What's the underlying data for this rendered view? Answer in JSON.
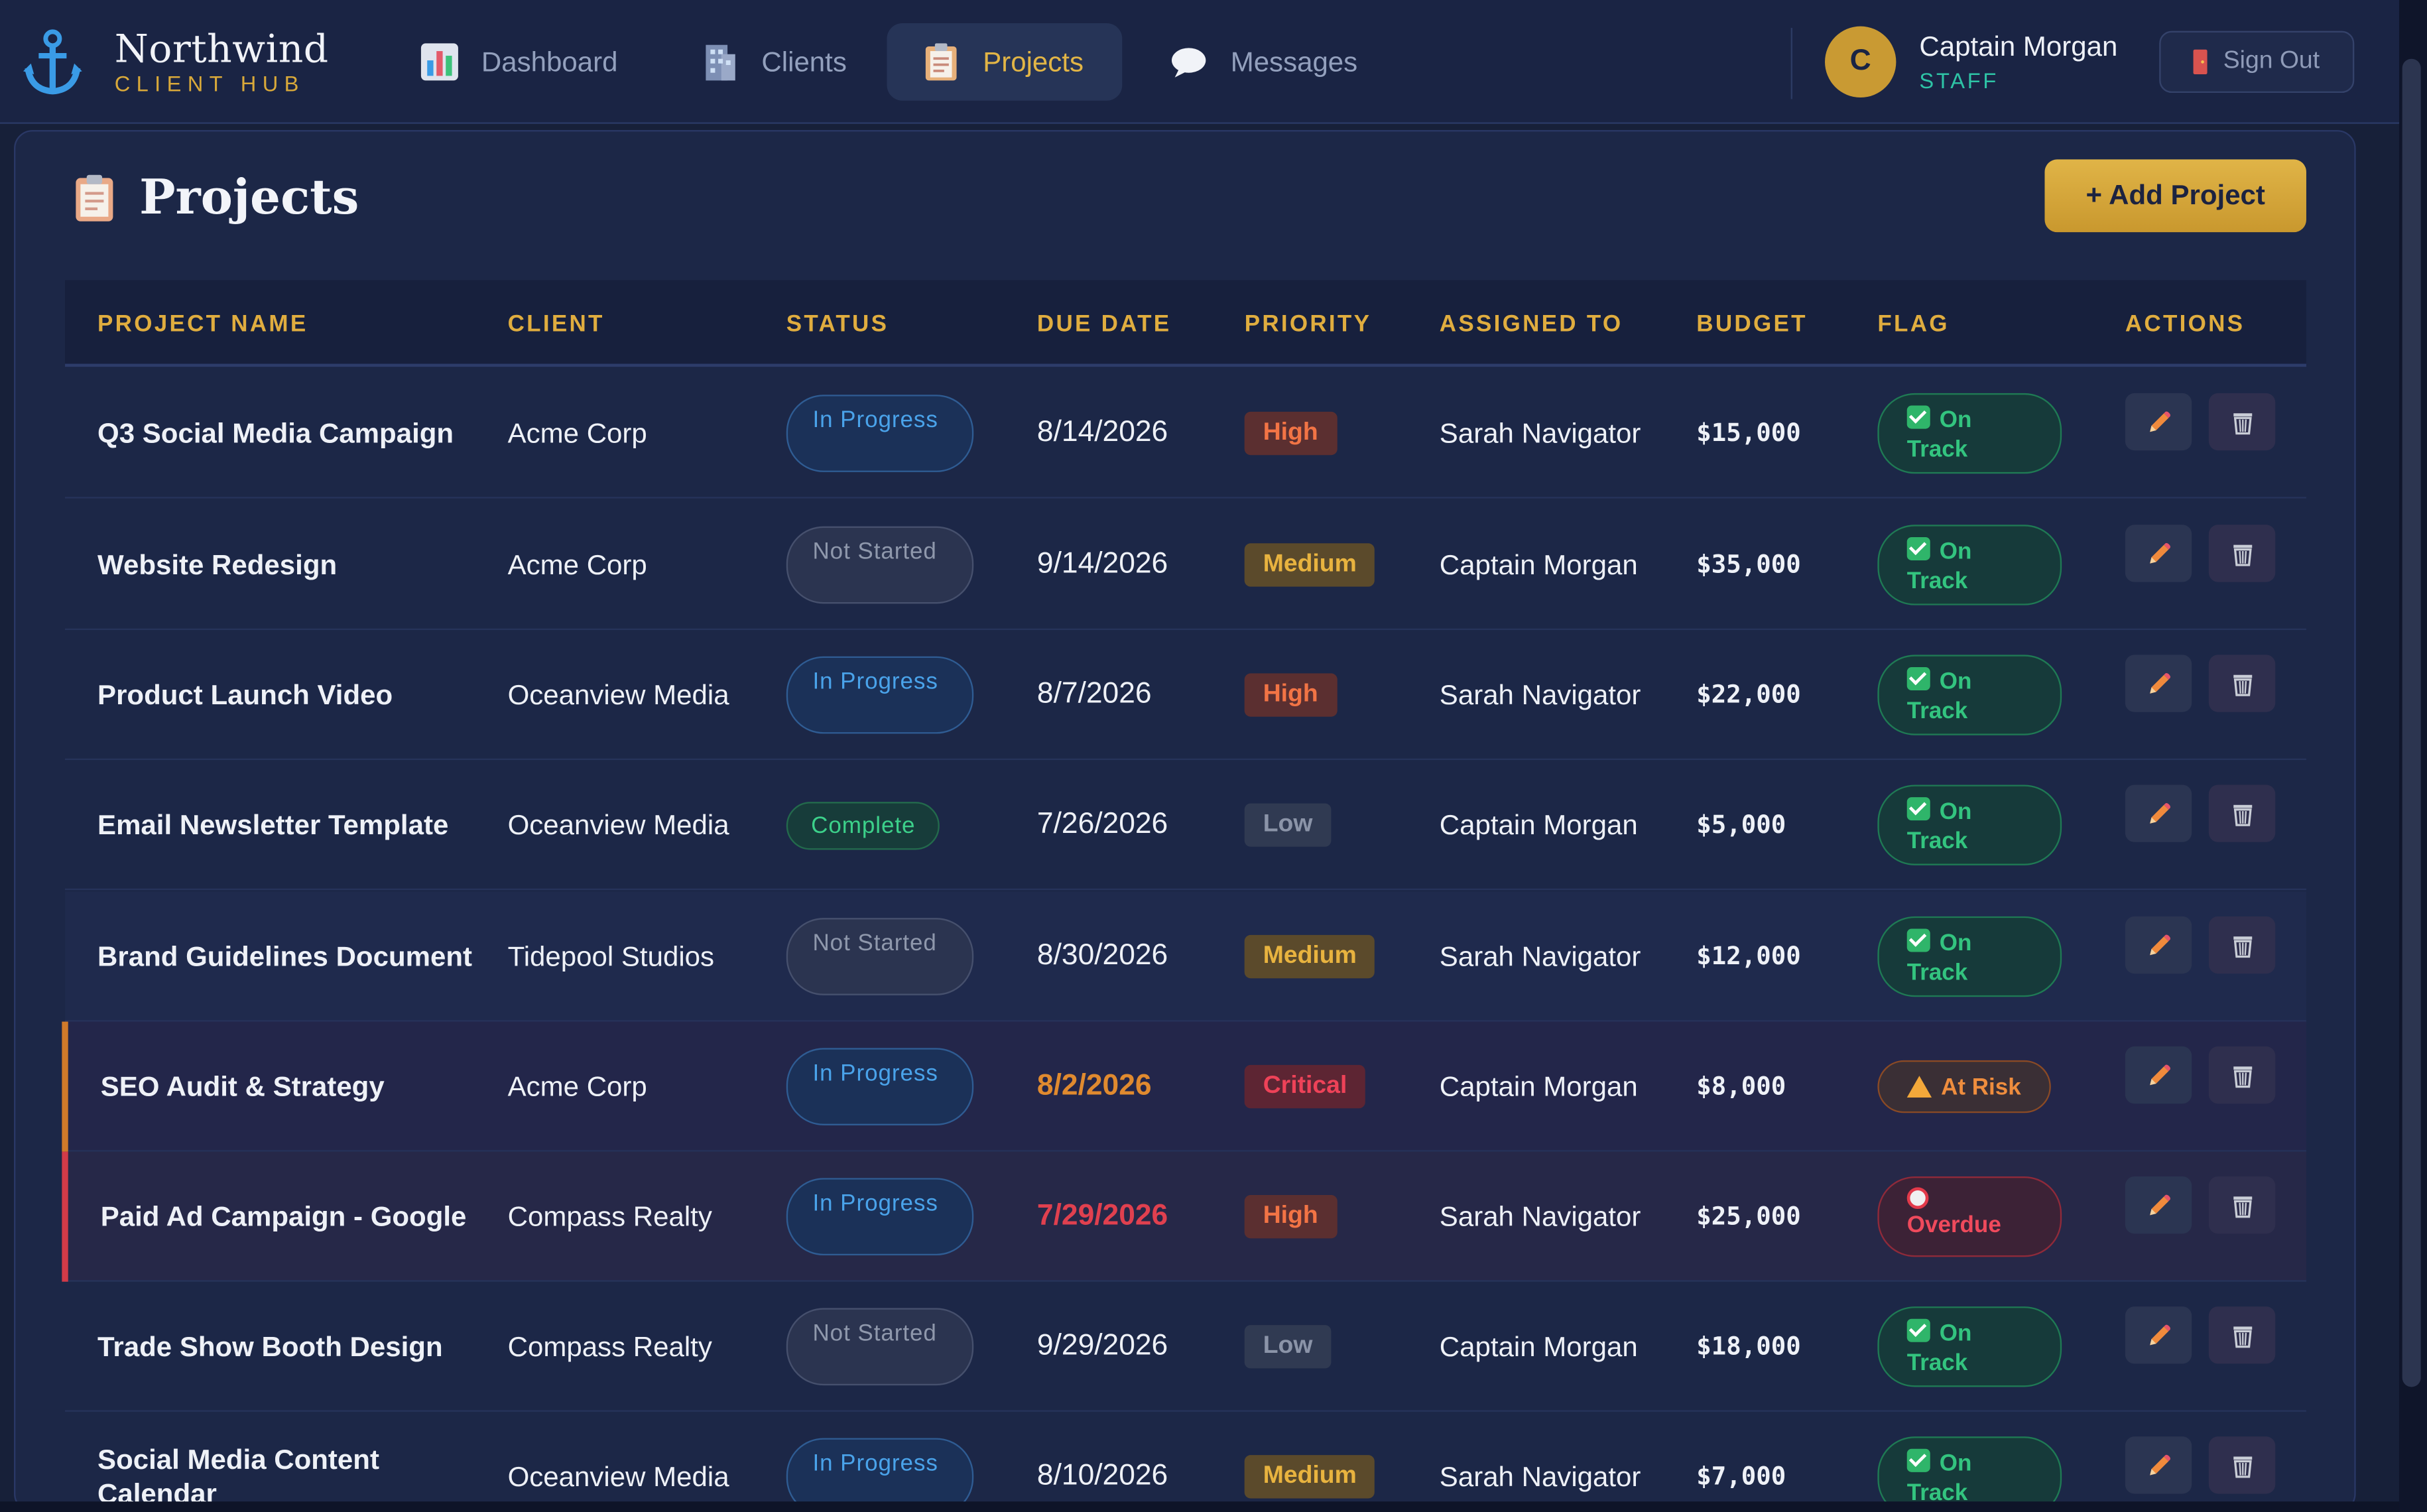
{
  "brand": {
    "name": "Northwind",
    "subtitle": "CLIENT HUB"
  },
  "nav": [
    {
      "label": "Dashboard",
      "icon": "bar-chart-icon",
      "active": false
    },
    {
      "label": "Clients",
      "icon": "office-building-icon",
      "active": false
    },
    {
      "label": "Projects",
      "icon": "clipboard-icon",
      "active": true
    },
    {
      "label": "Messages",
      "icon": "speech-bubble-icon",
      "active": false
    }
  ],
  "user": {
    "initial": "C",
    "name": "Captain Morgan",
    "role": "STAFF",
    "signout_label": "Sign Out"
  },
  "page": {
    "title": "Projects",
    "add_button": "+ Add Project"
  },
  "table": {
    "headers": [
      "PROJECT NAME",
      "CLIENT",
      "STATUS",
      "DUE DATE",
      "PRIORITY",
      "ASSIGNED TO",
      "BUDGET",
      "FLAG",
      "ACTIONS"
    ],
    "rows": [
      {
        "name": "Q3 Social Media Campaign",
        "client": "Acme Corp",
        "status": "In Progress",
        "due": "8/14/2026",
        "priority": "High",
        "assigned": "Sarah Navigator",
        "budget": "$15,000",
        "flag": "On Track"
      },
      {
        "name": "Website Redesign",
        "client": "Acme Corp",
        "status": "Not Started",
        "due": "9/14/2026",
        "priority": "Medium",
        "assigned": "Captain Morgan",
        "budget": "$35,000",
        "flag": "On Track"
      },
      {
        "name": "Product Launch Video",
        "client": "Oceanview Media",
        "status": "In Progress",
        "due": "8/7/2026",
        "priority": "High",
        "assigned": "Sarah Navigator",
        "budget": "$22,000",
        "flag": "On Track"
      },
      {
        "name": "Email Newsletter Template",
        "client": "Oceanview Media",
        "status": "Complete",
        "due": "7/26/2026",
        "priority": "Low",
        "assigned": "Captain Morgan",
        "budget": "$5,000",
        "flag": "On Track"
      },
      {
        "name": "Brand Guidelines Document",
        "client": "Tidepool Studios",
        "status": "Not Started",
        "due": "8/30/2026",
        "priority": "Medium",
        "assigned": "Sarah Navigator",
        "budget": "$12,000",
        "flag": "On Track"
      },
      {
        "name": "SEO Audit & Strategy",
        "client": "Acme Corp",
        "status": "In Progress",
        "due": "8/2/2026",
        "priority": "Critical",
        "assigned": "Captain Morgan",
        "budget": "$8,000",
        "flag": "At Risk"
      },
      {
        "name": "Paid Ad Campaign - Google",
        "client": "Compass Realty",
        "status": "In Progress",
        "due": "7/29/2026",
        "priority": "High",
        "assigned": "Sarah Navigator",
        "budget": "$25,000",
        "flag": "Overdue"
      },
      {
        "name": "Trade Show Booth Design",
        "client": "Compass Realty",
        "status": "Not Started",
        "due": "9/29/2026",
        "priority": "Low",
        "assigned": "Captain Morgan",
        "budget": "$18,000",
        "flag": "On Track"
      },
      {
        "name": "Social Media Content Calendar",
        "client": "Oceanview Media",
        "status": "In Progress",
        "due": "8/10/2026",
        "priority": "Medium",
        "assigned": "Sarah Navigator",
        "budget": "$7,000",
        "flag": "On Track"
      }
    ]
  },
  "colors": {
    "background": "#172039",
    "accent": "#e0ad3f",
    "teal": "#2ec4a6",
    "danger": "#e0404f",
    "warning": "#e08a2f"
  }
}
